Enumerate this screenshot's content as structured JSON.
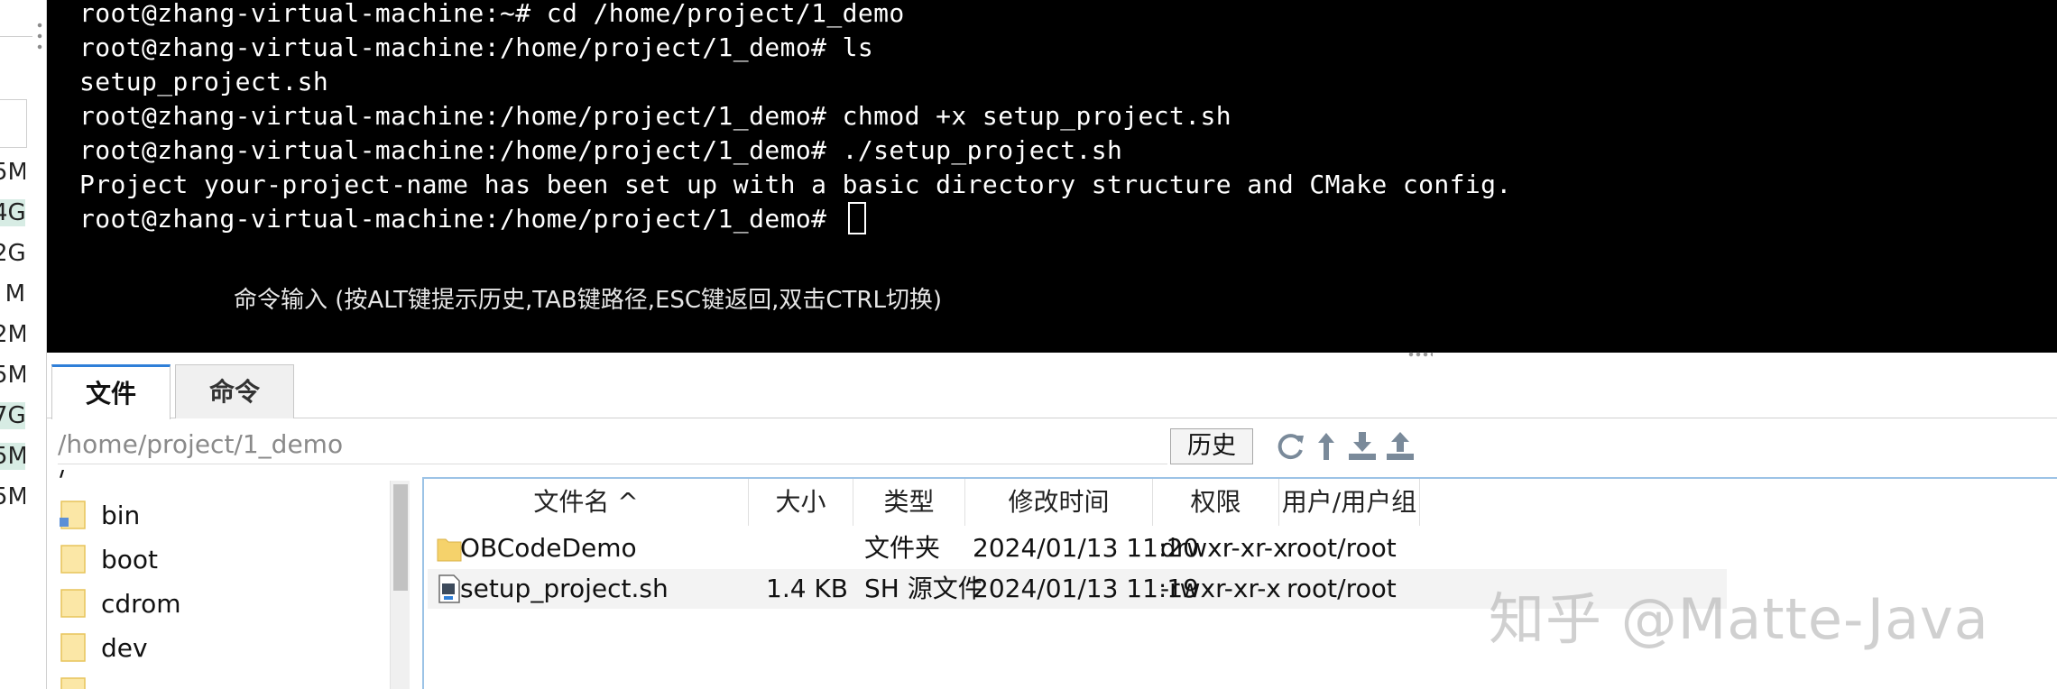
{
  "sidebar_sizes": [
    {
      "text": "5M",
      "highlight": false
    },
    {
      "text": "4G",
      "highlight": true
    },
    {
      "text": "2G",
      "highlight": false
    },
    {
      "text": "M",
      "highlight": false
    },
    {
      "text": "2M",
      "highlight": false
    },
    {
      "text": "5M",
      "highlight": false
    },
    {
      "text": "7G",
      "highlight": true
    },
    {
      "text": "5M",
      "highlight": true
    },
    {
      "text": "5M",
      "highlight": false
    }
  ],
  "terminal": {
    "lines": [
      "root@zhang-virtual-machine:~# cd /home/project/1_demo",
      "root@zhang-virtual-machine:/home/project/1_demo# ls",
      "setup_project.sh",
      "root@zhang-virtual-machine:/home/project/1_demo# chmod +x setup_project.sh",
      "root@zhang-virtual-machine:/home/project/1_demo# ./setup_project.sh",
      "Project your-project-name has been set up with a basic directory structure and CMake config.",
      "root@zhang-virtual-machine:/home/project/1_demo# "
    ],
    "command_hint": "命令输入 (按ALT键提示历史,TAB键路径,ESC键返回,双击CTRL切换)"
  },
  "tabs": [
    {
      "label": "文件",
      "active": true
    },
    {
      "label": "命令",
      "active": false
    }
  ],
  "path_bar": {
    "path": "/home/project/1_demo",
    "history_label": "历史"
  },
  "toolbar_icons": [
    "refresh-icon",
    "up-arrow-icon",
    "download-icon",
    "upload-icon"
  ],
  "tree": {
    "root_label": "/",
    "items": [
      "bin",
      "boot",
      "cdrom",
      "dev"
    ]
  },
  "file_table": {
    "columns": [
      "文件名 ^",
      "大小",
      "类型",
      "修改时间",
      "权限",
      "用户/用户组"
    ],
    "rows": [
      {
        "name": "OBCodeDemo",
        "size": "",
        "type": "文件夹",
        "modified": "2024/01/13 11:20",
        "perm": "drwxr-xr-x",
        "owner": "root/root",
        "icon": "folder-icon"
      },
      {
        "name": "setup_project.sh",
        "size": "1.4 KB",
        "type": "SH 源文件",
        "modified": "2024/01/13 11:19",
        "perm": "-rwxr-xr-x",
        "owner": "root/root",
        "icon": "shell-file-icon"
      }
    ]
  },
  "watermark": "知乎 @Matte-Java",
  "colors": {
    "terminal_bg": "#000000",
    "terminal_fg": "#ffffff",
    "tab_accent": "#2f7fd8",
    "folder": "#f5d26b",
    "list_border": "#9cc3e6"
  }
}
